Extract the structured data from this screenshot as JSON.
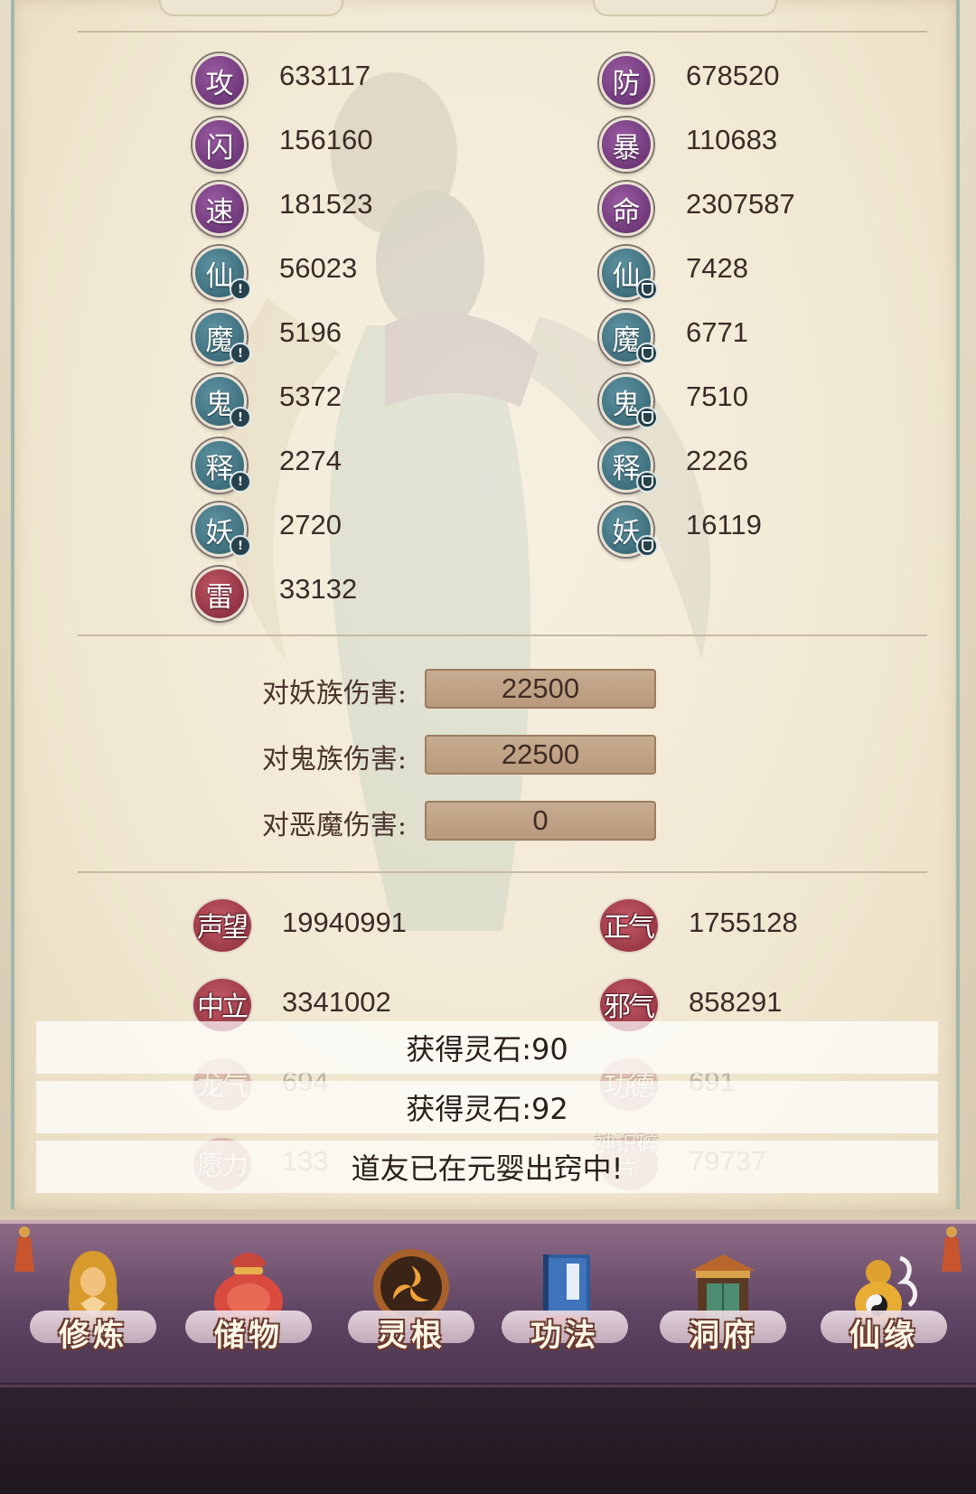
{
  "colors": {
    "badge_attack": "#7a3f86",
    "badge_resist": "#3f7584",
    "badge_thunder": "#9b3645",
    "reputation_badge": "#a8404e",
    "damage_box": "#bfa286",
    "bottom_bar": "#6b4d6c"
  },
  "stats": {
    "left": [
      {
        "label": "攻",
        "value": "633117",
        "style": "purple",
        "icon": "attack-icon"
      },
      {
        "label": "闪",
        "value": "156160",
        "style": "purple",
        "icon": "dodge-icon"
      },
      {
        "label": "速",
        "value": "181523",
        "style": "purple",
        "icon": "speed-icon"
      },
      {
        "label": "仙",
        "value": "56023",
        "style": "teal",
        "icon": "immortal-attack-icon"
      },
      {
        "label": "魔",
        "value": "5196",
        "style": "teal",
        "icon": "demon-attack-icon"
      },
      {
        "label": "鬼",
        "value": "5372",
        "style": "teal",
        "icon": "ghost-attack-icon"
      },
      {
        "label": "释",
        "value": "2274",
        "style": "teal",
        "icon": "buddha-attack-icon"
      },
      {
        "label": "妖",
        "value": "2720",
        "style": "teal",
        "icon": "monster-attack-icon"
      },
      {
        "label": "雷",
        "value": "33132",
        "style": "red",
        "icon": "thunder-icon"
      }
    ],
    "right": [
      {
        "label": "防",
        "value": "678520",
        "style": "purple",
        "icon": "defense-icon"
      },
      {
        "label": "暴",
        "value": "110683",
        "style": "purple",
        "icon": "critical-icon"
      },
      {
        "label": "命",
        "value": "2307587",
        "style": "purple",
        "icon": "health-icon"
      },
      {
        "label": "仙",
        "value": "7428",
        "style": "teal",
        "icon": "immortal-defense-icon"
      },
      {
        "label": "魔",
        "value": "6771",
        "style": "teal",
        "icon": "demon-defense-icon"
      },
      {
        "label": "鬼",
        "value": "7510",
        "style": "teal",
        "icon": "ghost-defense-icon"
      },
      {
        "label": "释",
        "value": "2226",
        "style": "teal",
        "icon": "buddha-defense-icon"
      },
      {
        "label": "妖",
        "value": "16119",
        "style": "teal",
        "icon": "monster-defense-icon"
      }
    ]
  },
  "damage_bonus": [
    {
      "label": "对妖族伤害:",
      "value": "22500"
    },
    {
      "label": "对鬼族伤害:",
      "value": "22500"
    },
    {
      "label": "对恶魔伤害:",
      "value": "0"
    }
  ],
  "reputation": {
    "left": [
      {
        "label": "声望",
        "value": "19940991"
      },
      {
        "label": "中立",
        "value": "3341002"
      },
      {
        "label": "龙气",
        "value": "694"
      },
      {
        "label": "愿力",
        "value": "133"
      }
    ],
    "right": [
      {
        "label": "正气",
        "value": "1755128"
      },
      {
        "label": "邪气",
        "value": "858291"
      },
      {
        "label": "功德",
        "value": "691"
      },
      {
        "label": "神识碎片",
        "value": "79737"
      }
    ]
  },
  "toasts": [
    "获得灵石:90",
    "获得灵石:92",
    "道友已在元婴出窍中!"
  ],
  "nav": [
    {
      "label": "修炼",
      "icon": "cultivation-monk-icon"
    },
    {
      "label": "储物",
      "icon": "storage-bag-icon"
    },
    {
      "label": "灵根",
      "icon": "spirit-root-icon"
    },
    {
      "label": "功法",
      "icon": "technique-book-icon"
    },
    {
      "label": "洞府",
      "icon": "cave-dwelling-icon"
    },
    {
      "label": "仙缘",
      "icon": "immortal-fate-gourd-icon"
    }
  ]
}
